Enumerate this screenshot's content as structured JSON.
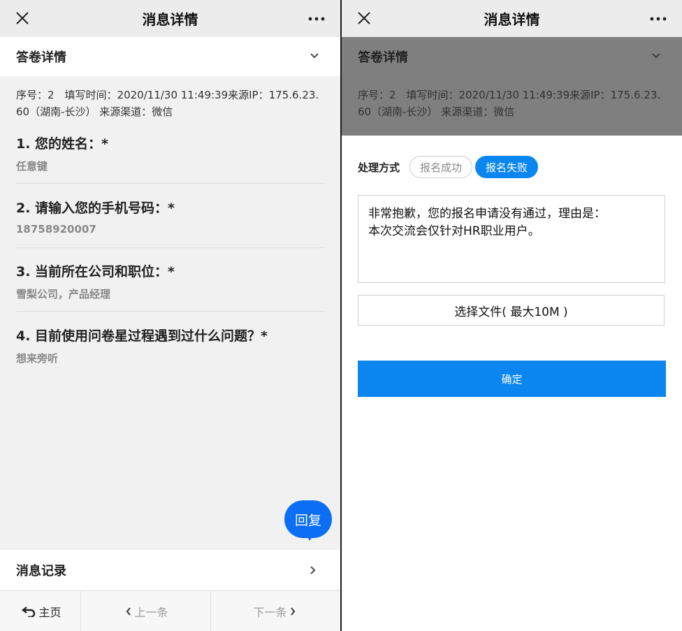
{
  "left": {
    "nav": {
      "title": "消息详情"
    },
    "section_title": "答卷详情",
    "meta": "序号：2　填写时间：2020/11/30 11:49:39来源IP：175.6.23.60（湖南-长沙） 来源渠道：微信",
    "questions": [
      {
        "title": "1. 您的姓名：*",
        "answer": "任意键"
      },
      {
        "title": "2. 请输入您的手机号码：*",
        "answer": "18758920007"
      },
      {
        "title": "3. 当前所在公司和职位：*",
        "answer": "雪梨公司，产品经理"
      },
      {
        "title": "4. 目前使用问卷星过程遇到过什么问题？*",
        "answer": "想来旁听"
      }
    ],
    "reply_label": "回复",
    "record_label": "消息记录",
    "bottom": {
      "home": "主页",
      "prev": "上一条",
      "next": "下一条"
    }
  },
  "right": {
    "nav": {
      "title": "消息详情"
    },
    "section_title": "答卷详情",
    "meta": "序号：2　填写时间：2020/11/30 11:49:39来源IP：175.6.23.60（湖南-长沙） 来源渠道：微信",
    "handle_label": "处理方式",
    "options": [
      "报名成功",
      "报名失败"
    ],
    "selected_option": "报名失败",
    "message": "非常抱歉，您的报名申请没有通过，理由是：\n本次交流会仅针对HR职业用户。",
    "file_label": "选择文件( 最大10M )",
    "confirm_label": "确定"
  },
  "colors": {
    "accent": "#0b86f0",
    "reply_bubble": "#0b6ef5",
    "overlay": "#7f7f7f"
  }
}
